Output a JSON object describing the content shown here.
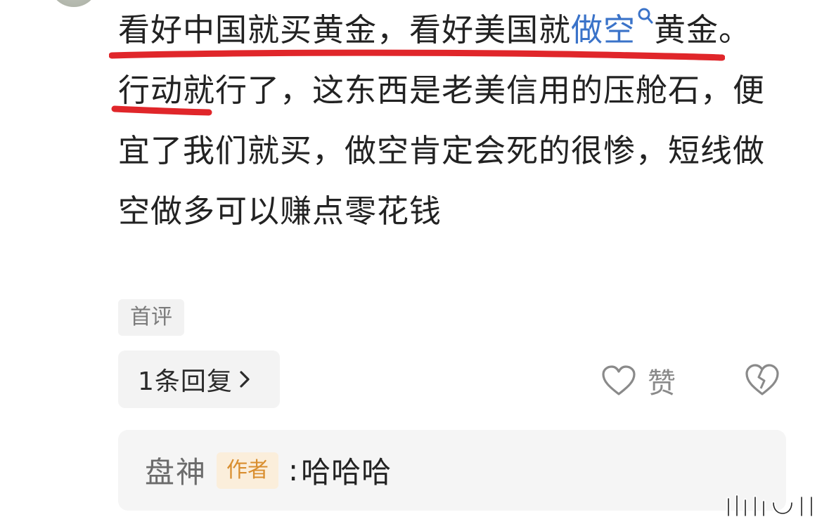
{
  "comment": {
    "text_before_link": "看好中国就买黄金，看好美国就",
    "link_text": "做空",
    "text_after_link": "黄金。行动就行了，这东西是老美信用的压舱石，便宜了我们就买，做空肯定会死的很惨，短线做空做多可以赚点零花钱",
    "search_icon": "search-icon",
    "first_comment_tag": "首评"
  },
  "actions": {
    "reply_count_label": "1条回复",
    "like_label": "赞",
    "like_icon": "heart-icon",
    "dislike_icon": "broken-heart-icon"
  },
  "reply_preview": {
    "author": "盘神",
    "author_badge": "作者",
    "separator": ":",
    "text": "哈哈哈"
  },
  "colors": {
    "link": "#3a73c9",
    "underline_annotation": "#e0262a",
    "badge_text": "#d98e2f",
    "badge_bg": "#fbeedb"
  }
}
